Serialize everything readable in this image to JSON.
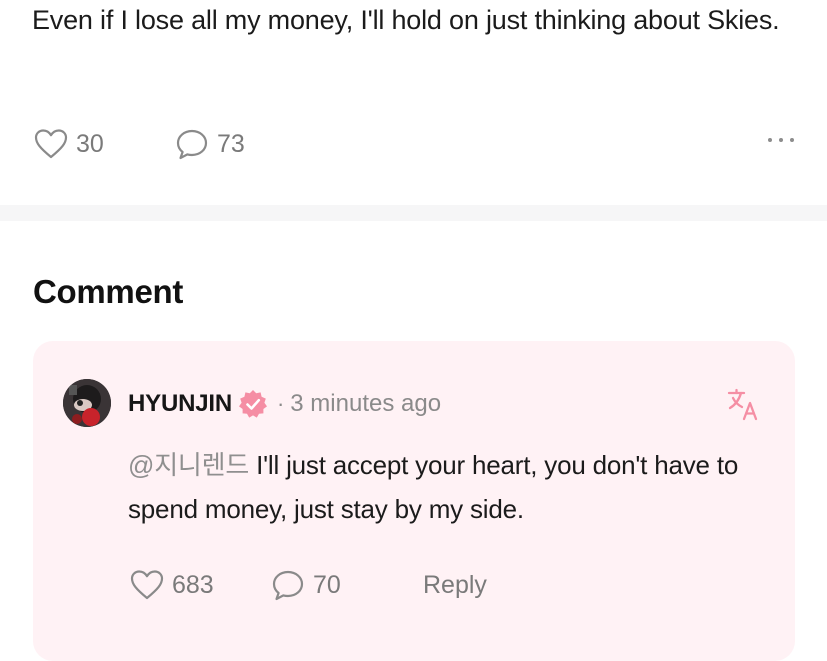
{
  "post": {
    "text": "Even if I lose all my money, I'll hold on just thinking about Skies.",
    "likes": "30",
    "comments": "73",
    "more_icon": "more-horizontal-icon"
  },
  "comments_section": {
    "heading": "Comment",
    "items": [
      {
        "author": "HYUNJIN",
        "separator": "·",
        "time": "3 minutes ago",
        "mention": "@지니렌드",
        "text": " I'll just accept your heart, you don't have to spend money, just stay by my side.",
        "likes": "683",
        "replies": "70",
        "reply_label": "Reply",
        "verified_icon": "verified-badge-icon",
        "translate_icon": "translate-icon"
      }
    ]
  },
  "colors": {
    "accent_pink": "#f58ea4",
    "card_bg": "#fff2f5",
    "muted_text": "#7a7a7a"
  }
}
